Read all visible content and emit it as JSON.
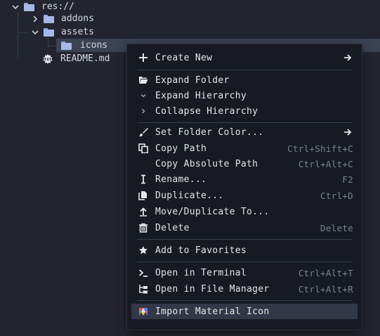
{
  "tree": {
    "root": {
      "label": "res://"
    },
    "items": [
      {
        "label": "addons"
      },
      {
        "label": "assets"
      },
      {
        "label": "icons"
      },
      {
        "label": "README.md"
      }
    ]
  },
  "menu": {
    "items": [
      {
        "label": "Create New",
        "shortcut": "",
        "icon": "plus-icon"
      },
      {
        "label": "Expand Folder",
        "shortcut": "",
        "icon": "folder-open-icon"
      },
      {
        "label": "Expand Hierarchy",
        "shortcut": "",
        "icon": "chevron-down-icon"
      },
      {
        "label": "Collapse Hierarchy",
        "shortcut": "",
        "icon": "chevron-right-icon"
      },
      {
        "label": "Set Folder Color...",
        "shortcut": "",
        "icon": "brush-icon"
      },
      {
        "label": "Copy Path",
        "shortcut": "Ctrl+Shift+C",
        "icon": "copy-icon"
      },
      {
        "label": "Copy Absolute Path",
        "shortcut": "Ctrl+Alt+C",
        "icon": ""
      },
      {
        "label": "Rename...",
        "shortcut": "F2",
        "icon": "rename-cursor-icon"
      },
      {
        "label": "Duplicate...",
        "shortcut": "Ctrl+D",
        "icon": "duplicate-icon"
      },
      {
        "label": "Move/Duplicate To...",
        "shortcut": "",
        "icon": "move-up-icon"
      },
      {
        "label": "Delete",
        "shortcut": "Delete",
        "icon": "trash-icon"
      },
      {
        "label": "Add to Favorites",
        "shortcut": "",
        "icon": "star-icon"
      },
      {
        "label": "Open in Terminal",
        "shortcut": "Ctrl+Alt+T",
        "icon": "terminal-icon"
      },
      {
        "label": "Open in File Manager",
        "shortcut": "Ctrl+Alt+R",
        "icon": "file-manager-icon"
      },
      {
        "label": "Import Material Icon",
        "shortcut": "",
        "icon": "material-icon"
      }
    ]
  },
  "colors": {
    "background": "#22252f",
    "menu_bg": "#171a22",
    "highlight": "#323847",
    "folder": "#a6b8e6"
  }
}
